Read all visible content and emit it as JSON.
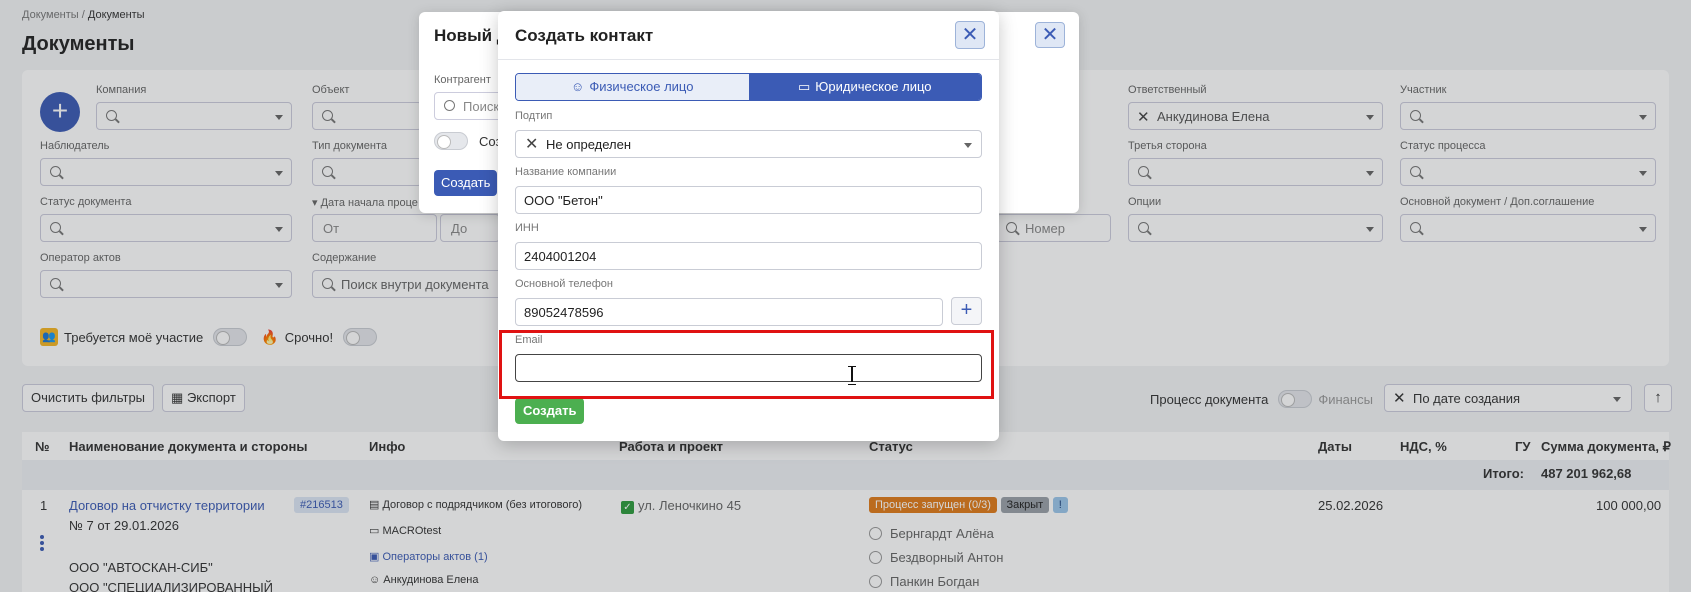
{
  "breadcrumb": {
    "root": "Документы",
    "sep": "/",
    "current": "Документы"
  },
  "page_title": "Документы",
  "filters": {
    "company": "Компания",
    "object": "Объект",
    "responsible": "Ответственный",
    "responsible_value": "Анкудинова Елена",
    "participant": "Участник",
    "observer": "Наблюдатель",
    "doc_type": "Тип документа",
    "third_party": "Третья сторона",
    "process_status": "Статус процесса",
    "doc_status": "Статус документа",
    "start_date": "Дата начала проце",
    "from_placeholder": "От",
    "to_placeholder": "До",
    "number_placeholder": "Номер",
    "options": "Опции",
    "main_doc": "Основной документ / Доп.соглашение",
    "acts_operator": "Оператор актов",
    "content": "Содержание",
    "content_placeholder": "Поиск внутри документа",
    "requires_me": "Требуется моё участие",
    "urgent": "Срочно!"
  },
  "actions": {
    "clear": "Очистить фильтры",
    "export": "Экспорт",
    "process": "Процесс документа",
    "finance": "Финансы",
    "sort": "По дате создания"
  },
  "table": {
    "headers": [
      "№",
      "Наименование документа и стороны",
      "Инфо",
      "Работа и проект",
      "Статус",
      "Даты",
      "НДС, %",
      "ГУ",
      "Сумма документа, ₽"
    ],
    "total_label": "Итого:",
    "total_value": "487 201 962,68",
    "row": {
      "num": "1",
      "name": "Договор на отчистку территории",
      "id": "#216513",
      "number": "№ 7  от 29.01.2026",
      "party1": "ООО \"АВТОСКАН-СИБ\"",
      "party2": "ООО \"СПЕЦИАЛИЗИРОВАННЫЙ",
      "info1": "Договор с подрядчиком (без итогового)",
      "info2": "MACROtest",
      "info3": "Операторы актов (1)",
      "info4": "Анкудинова Елена",
      "work": "ул. Леночкино 45",
      "status_process": "Процесс запущен (0/3)",
      "status_closed": "Закрыт",
      "status_flag": "!",
      "approver1": "Бернгардт Алёна",
      "approver2": "Бездворный Антон",
      "approver3": "Панкин Богдан",
      "date": "25.02.2026",
      "sum": "100 000,00"
    }
  },
  "back_modal": {
    "title": "Новый д",
    "counterparty": "Контрагент",
    "search": "Поиск",
    "toggle_label": "Соз",
    "create": "Создать"
  },
  "modal": {
    "title": "Создать контакт",
    "tab_person": "Физическое лицо",
    "tab_company": "Юридическое лицо",
    "subtype_label": "Подтип",
    "subtype_value": "Не определен",
    "company_label": "Название компании",
    "company_value": "ООО \"Бетон\"",
    "inn_label": "ИНН",
    "inn_value": "2404001204",
    "phone_label": "Основной телефон",
    "phone_value": "89052478596",
    "email_label": "Email",
    "email_value": "",
    "submit": "Создать"
  },
  "colors": {
    "accent": "#3b5bb5",
    "success": "#4caf50",
    "highlight": "#e01212"
  }
}
